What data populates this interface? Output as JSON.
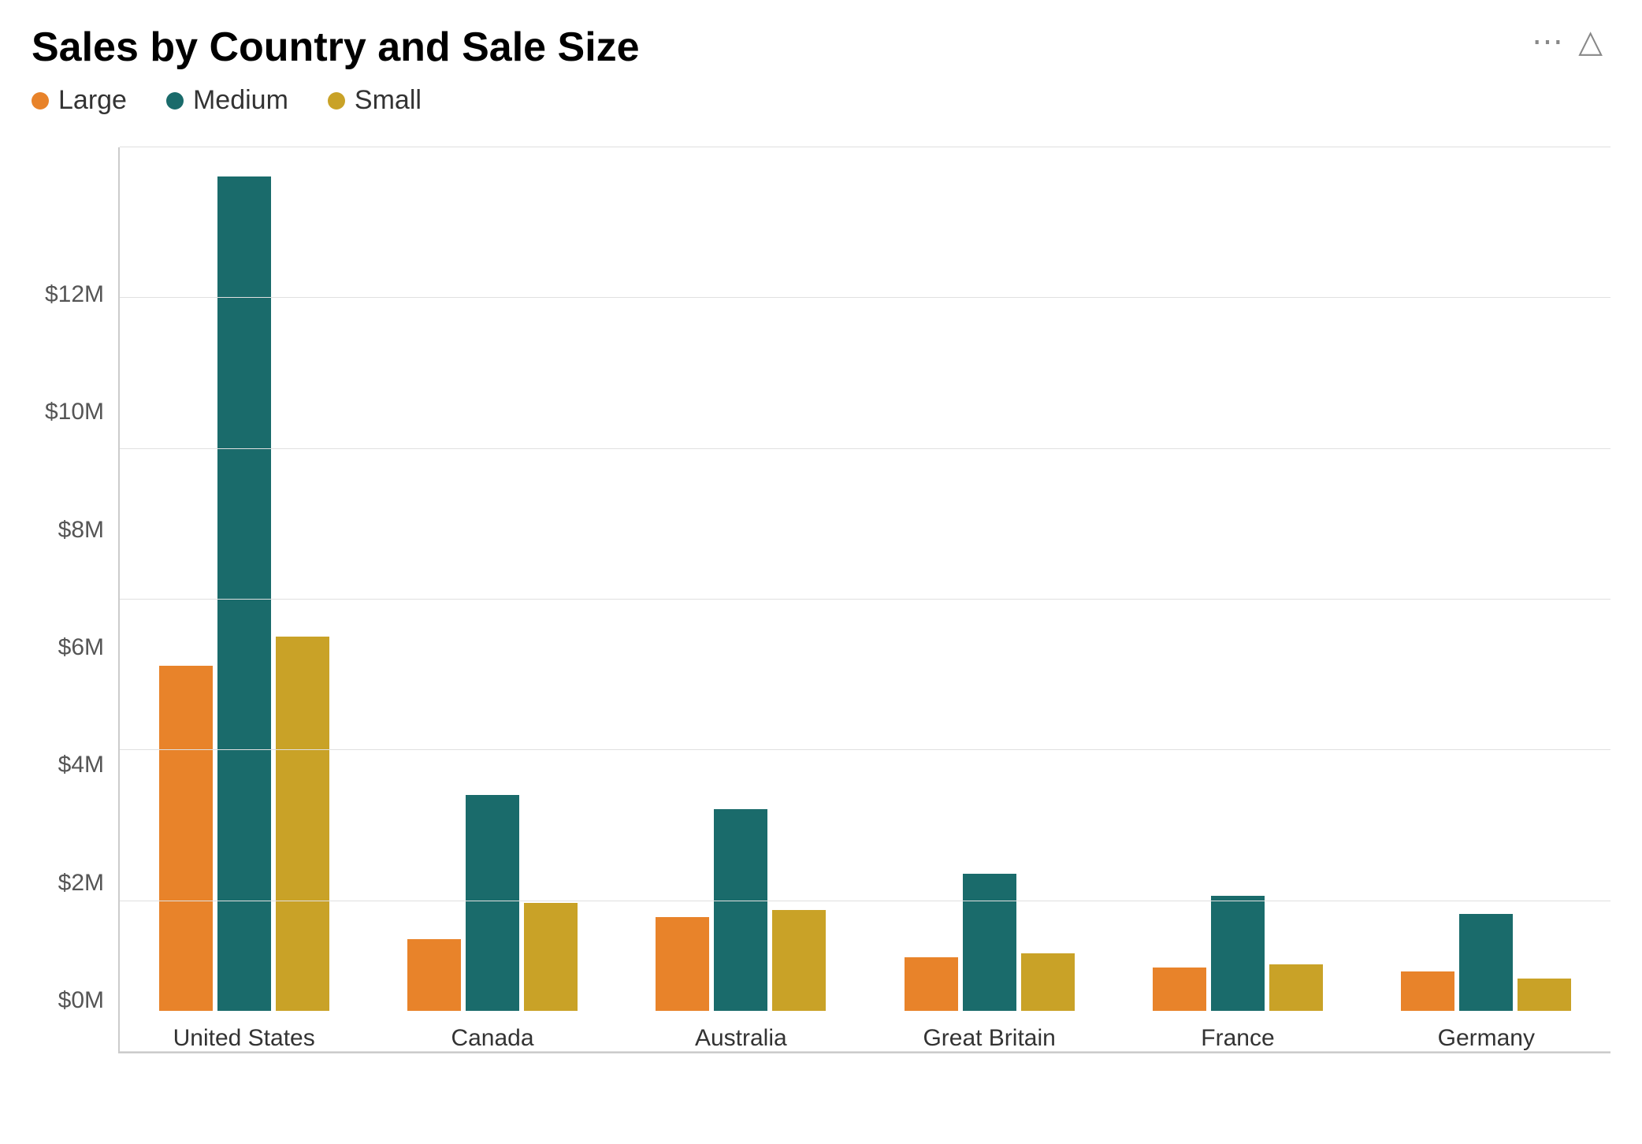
{
  "title": "Sales by Country and Sale Size",
  "legend": {
    "items": [
      {
        "label": "Large",
        "color": "#E8832A"
      },
      {
        "label": "Medium",
        "color": "#1A6B6B"
      },
      {
        "label": "Small",
        "color": "#C9A227"
      }
    ]
  },
  "yAxis": {
    "labels": [
      "$12M",
      "$10M",
      "$8M",
      "$6M",
      "$4M",
      "$2M",
      "$0M"
    ],
    "maxValue": 12
  },
  "countries": [
    {
      "name": "United States",
      "large": 4.8,
      "medium": 11.6,
      "small": 5.2
    },
    {
      "name": "Canada",
      "large": 1.0,
      "medium": 3.0,
      "small": 1.5
    },
    {
      "name": "Australia",
      "large": 1.3,
      "medium": 2.8,
      "small": 1.4
    },
    {
      "name": "Great Britain",
      "large": 0.75,
      "medium": 1.9,
      "small": 0.8
    },
    {
      "name": "France",
      "large": 0.6,
      "medium": 1.6,
      "small": 0.65
    },
    {
      "name": "Germany",
      "large": 0.55,
      "medium": 1.35,
      "small": 0.45
    }
  ],
  "colors": {
    "large": "#E8832A",
    "medium": "#1A6B6B",
    "small": "#C9A227"
  },
  "icons": {
    "filter": "⊿",
    "ellipsis": "…"
  }
}
